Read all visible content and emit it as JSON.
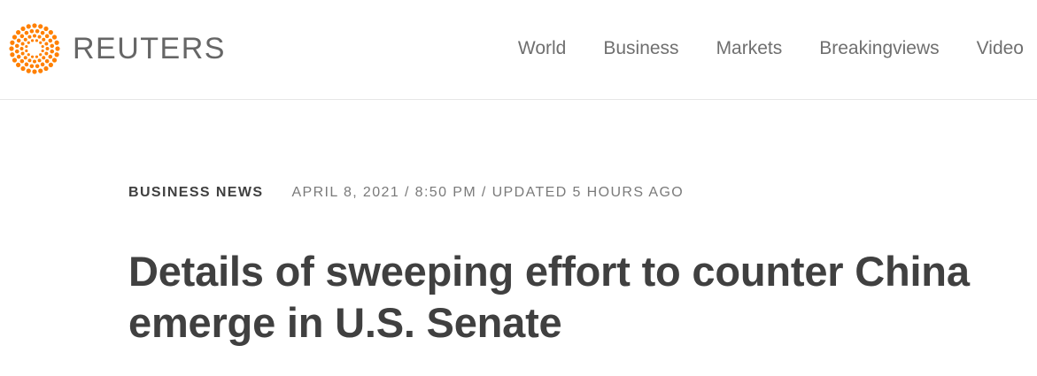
{
  "header": {
    "brand": "REUTERS",
    "logo_icon": "reuters-dot-circle-logo",
    "brand_color": "#ff8000",
    "nav": [
      "World",
      "Business",
      "Markets",
      "Breakingviews",
      "Video"
    ]
  },
  "article": {
    "section": "BUSINESS NEWS",
    "timestamp": "APRIL 8, 2021 / 8:50 PM / UPDATED 5 HOURS AGO",
    "headline": "Details of sweeping effort to counter China emerge in U.S. Senate"
  }
}
